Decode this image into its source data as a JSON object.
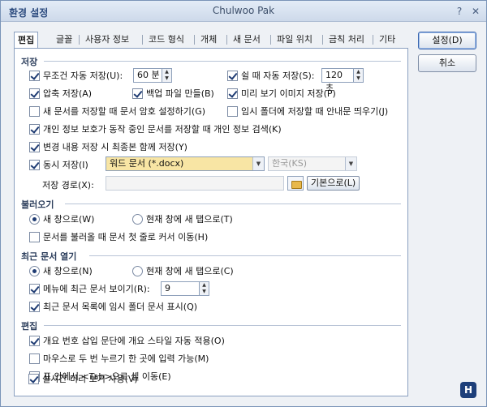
{
  "window": {
    "title_left": "환경 설정",
    "title_center": "Chulwoo Pak",
    "help_glyph": "?",
    "close_glyph": "✕"
  },
  "tabs": [
    "편집",
    "글꼴",
    "사용자 정보",
    "코드 형식",
    "개체",
    "새 문서",
    "파일 위치",
    "금칙 처리",
    "기타"
  ],
  "buttons": {
    "ok": "설정(D)",
    "cancel": "취소"
  },
  "sections": {
    "save": {
      "title": "저장",
      "autosave_idle": "무조건 자동 저장(U):",
      "autosave_idle_value": "60 분",
      "autosave_rest": "쉴 때 자동 저장(S):",
      "autosave_rest_value": "120 초",
      "compress": "압축 저장(A)",
      "backup": "백업 파일 만들(B)",
      "preview_image": "미리 보기 이미지 저장(P)",
      "password": "새 문서를 저장할 때 문서 암호 설정하기(G)",
      "temp_notice": "임시 폴더에 저장할 때 안내문 띄우기(J)",
      "privacy_check": "개인 정보 보호가 동작 중인 문서를 저장할 때 개인 정보 검색(K)",
      "changes_merge": "변경 내용 저장 시 최종본 함께 저장(Y)",
      "simultaneous": "동시 저장(I)",
      "format_value": "워드 문서 (*.docx)",
      "lang_value": "한국(KS)",
      "path_label": "저장 경로(X):",
      "path_value": "",
      "default_button": "기본으로(L)"
    },
    "open": {
      "title": "불러오기",
      "new_window": "새 창으로(W)",
      "new_tab": "현재 창에 새 탭으로(T)",
      "first_line": "문서를 불러올 때 문서 첫 줄로 커서 이동(H)"
    },
    "recent": {
      "title": "최근 문서 열기",
      "new_window": "새 창으로(N)",
      "new_tab": "현재 창에 새 탭으로(C)",
      "menu_show": "메뉴에 최근 문서 보이기(R):",
      "menu_show_value": "9",
      "temp_show": "최근 문서 목록에 임시 폴더 문서 표시(Q)"
    },
    "edit": {
      "title": "편집",
      "auto_style": "개요 번호 삽입 문단에 개요 스타일 자동 적용(O)",
      "double_click": "마우스로 두 번 누르기 한 곳에 입력 가능(M)",
      "tab_move": "표 안에서 <Tab>으로 셀 이동(E)",
      "live_preview": "실시간 미리 보기 사용(V)"
    }
  },
  "logo_text": "H",
  "colors": {
    "accent": "#1d3f7a",
    "highlight": "#f8e5a4",
    "panel_border": "#8aa0c0"
  }
}
